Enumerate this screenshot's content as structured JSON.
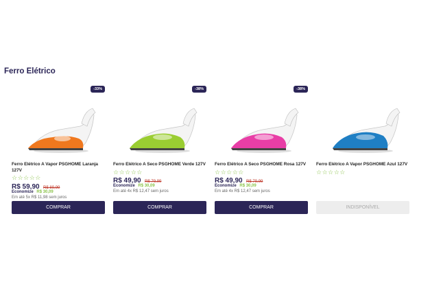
{
  "section_title": "Ferro Elétrico",
  "colors": {
    "brand": "#2b2557",
    "accent_green": "#8bc34a",
    "old_price": "#c0392b"
  },
  "products": [
    {
      "badge": "-33%",
      "name": "Ferro Elétrico A Vapor PSGHOME Laranja 127V",
      "stars": "☆☆☆☆☆",
      "price": "R$ 59,90",
      "old_price": "R$ 89,99",
      "save_label": "Economize",
      "save_value": "R$ 30,09",
      "installments": "Em até 5x R$ 11,98 sem juros",
      "button": "COMPRAR",
      "iron_color": "#f0781e",
      "iron_icon": "steam-iron-orange"
    },
    {
      "badge": "-38%",
      "name": "Ferro Elétrico A Seco PSGHOME Verde 127V",
      "stars": "☆☆☆☆☆",
      "price": "R$ 49,90",
      "old_price": "R$ 79,99",
      "save_label": "Economize",
      "save_value": "R$ 30,09",
      "installments": "Em até 4x R$ 12,47 sem juros",
      "button": "COMPRAR",
      "iron_color": "#9acd32",
      "iron_icon": "dry-iron-green"
    },
    {
      "badge": "-38%",
      "name": "Ferro Elétrico A Seco PSGHOME Rosa 127V",
      "stars": "☆☆☆☆☆",
      "price": "R$ 49,90",
      "old_price": "R$ 79,99",
      "save_label": "Economize",
      "save_value": "R$ 30,09",
      "installments": "Em até 4x R$ 12,47 sem juros",
      "button": "COMPRAR",
      "iron_color": "#e83ea6",
      "iron_icon": "dry-iron-pink"
    },
    {
      "name": "Ferro Elétrico A Vapor PSGHOME Azul 127V",
      "stars": "☆☆☆☆☆",
      "button": "INDISPONÍVEL",
      "iron_color": "#1f7fc4",
      "iron_icon": "steam-iron-blue"
    }
  ]
}
